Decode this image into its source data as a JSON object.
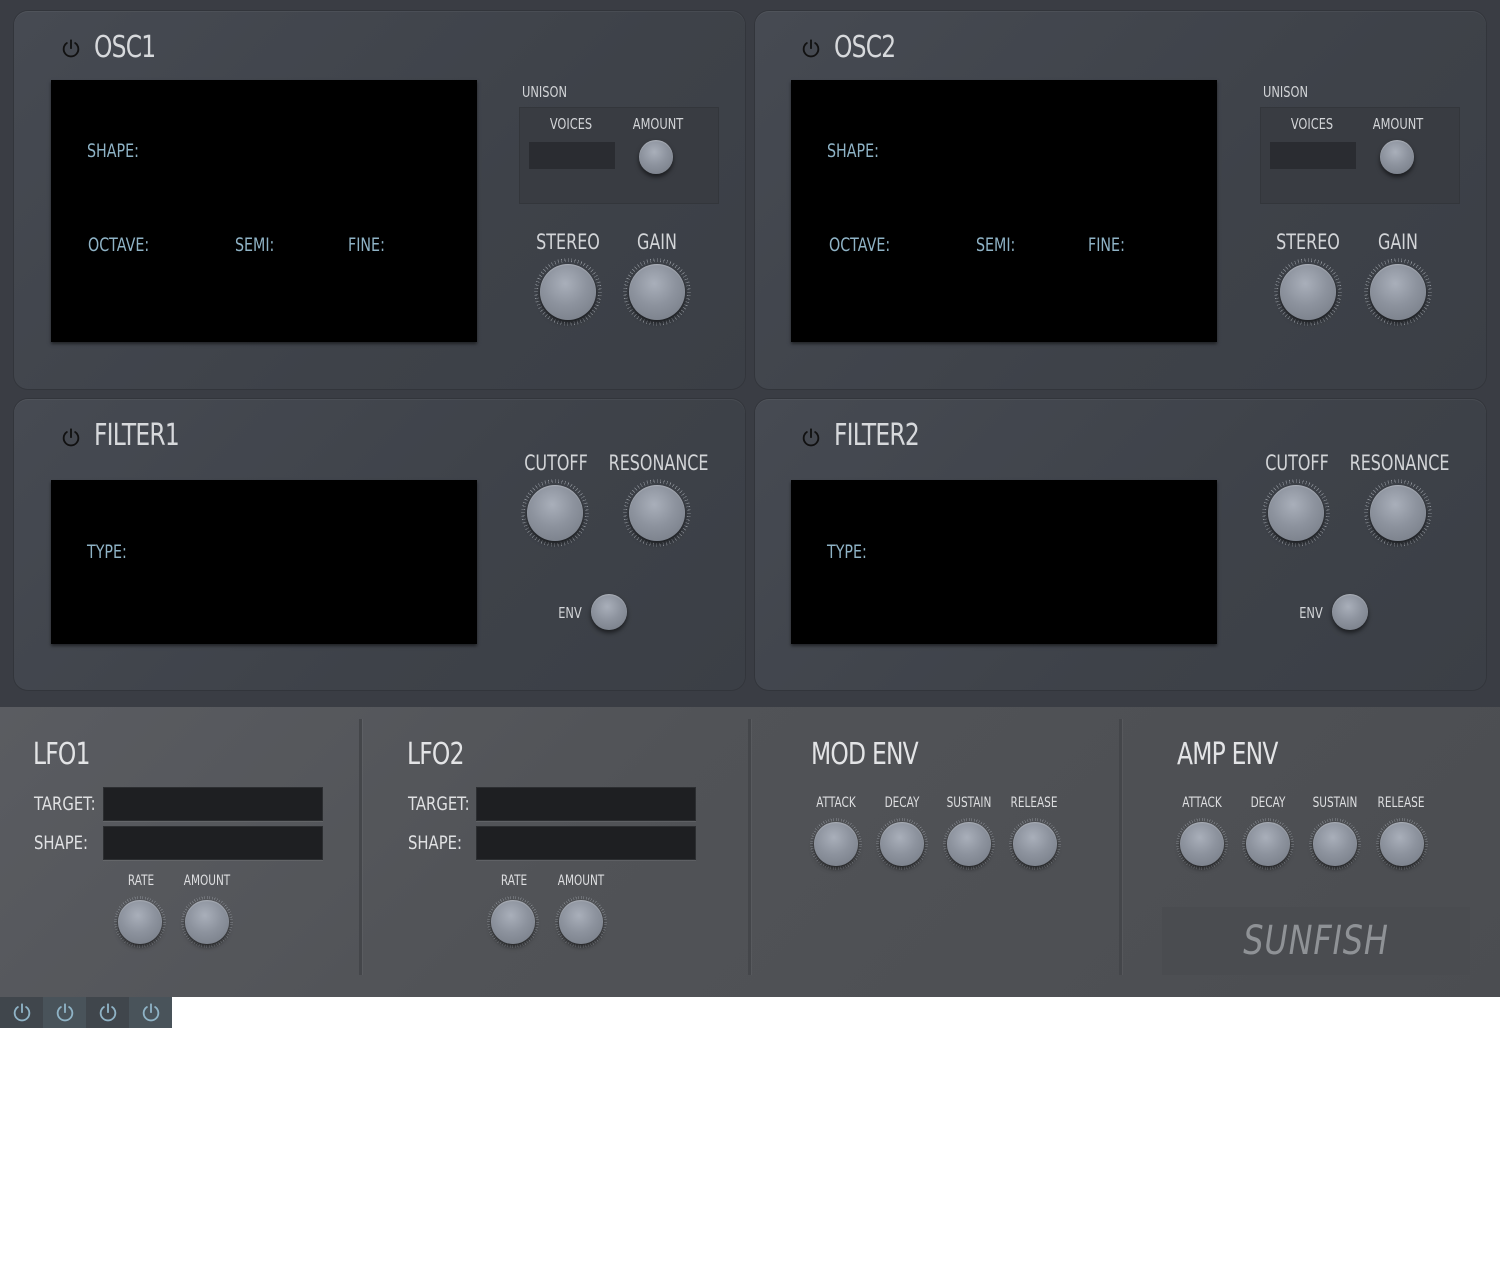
{
  "osc1": {
    "title": "OSC1",
    "shape_label": "SHAPE:",
    "octave_label": "OCTAVE:",
    "semi_label": "SEMI:",
    "fine_label": "FINE:",
    "unison_label": "UNISON",
    "voices_label": "VOICES",
    "amount_label": "AMOUNT",
    "stereo_label": "STEREO",
    "gain_label": "GAIN"
  },
  "osc2": {
    "title": "OSC2",
    "shape_label": "SHAPE:",
    "octave_label": "OCTAVE:",
    "semi_label": "SEMI:",
    "fine_label": "FINE:",
    "unison_label": "UNISON",
    "voices_label": "VOICES",
    "amount_label": "AMOUNT",
    "stereo_label": "STEREO",
    "gain_label": "GAIN"
  },
  "filter1": {
    "title": "FILTER1",
    "type_label": "TYPE:",
    "cutoff_label": "CUTOFF",
    "resonance_label": "RESONANCE",
    "env_label": "ENV"
  },
  "filter2": {
    "title": "FILTER2",
    "type_label": "TYPE:",
    "cutoff_label": "CUTOFF",
    "resonance_label": "RESONANCE",
    "env_label": "ENV"
  },
  "lfo1": {
    "title": "LFO1",
    "target_label": "TARGET:",
    "shape_label": "SHAPE:",
    "rate_label": "RATE",
    "amount_label": "AMOUNT"
  },
  "lfo2": {
    "title": "LFO2",
    "target_label": "TARGET:",
    "shape_label": "SHAPE:",
    "rate_label": "RATE",
    "amount_label": "AMOUNT"
  },
  "mod_env": {
    "title": "MOD ENV",
    "attack_label": "ATTACK",
    "decay_label": "DECAY",
    "sustain_label": "SUSTAIN",
    "release_label": "RELEASE"
  },
  "amp_env": {
    "title": "AMP ENV",
    "attack_label": "ATTACK",
    "decay_label": "DECAY",
    "sustain_label": "SUSTAIN",
    "release_label": "RELEASE"
  },
  "logo": "SUNFISH",
  "colors": {
    "panel_bg": "#3a3d44",
    "screen_bg": "#000000",
    "screen_label": "#8fb3c6",
    "bottom_bg": "#545659",
    "power_blue": "#8fb3c6"
  },
  "icons": {
    "power": "power-icon"
  }
}
